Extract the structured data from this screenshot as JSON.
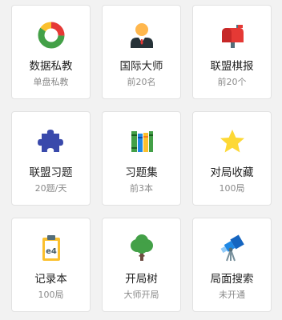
{
  "cards": [
    {
      "title": "数据私教",
      "subtitle": "单盘私教",
      "icon": "donut-chart-icon"
    },
    {
      "title": "国际大师",
      "subtitle": "前20名",
      "icon": "master-avatar-icon"
    },
    {
      "title": "联盟棋报",
      "subtitle": "前20个",
      "icon": "mailbox-icon"
    },
    {
      "title": "联盟习题",
      "subtitle": "20题/天",
      "icon": "puzzle-piece-icon"
    },
    {
      "title": "习题集",
      "subtitle": "前3本",
      "icon": "books-icon"
    },
    {
      "title": "对局收藏",
      "subtitle": "100局",
      "icon": "star-icon"
    },
    {
      "title": "记录本",
      "subtitle": "100局",
      "icon": "clipboard-icon",
      "icon_text": "e4"
    },
    {
      "title": "开局树",
      "subtitle": "大师开局",
      "icon": "tree-icon"
    },
    {
      "title": "局面搜索",
      "subtitle": "未开通",
      "icon": "telescope-icon"
    }
  ],
  "colors": {
    "background": "#f2f2f2",
    "card": "#ffffff",
    "title": "#222222",
    "subtitle": "#8a8a8a"
  }
}
